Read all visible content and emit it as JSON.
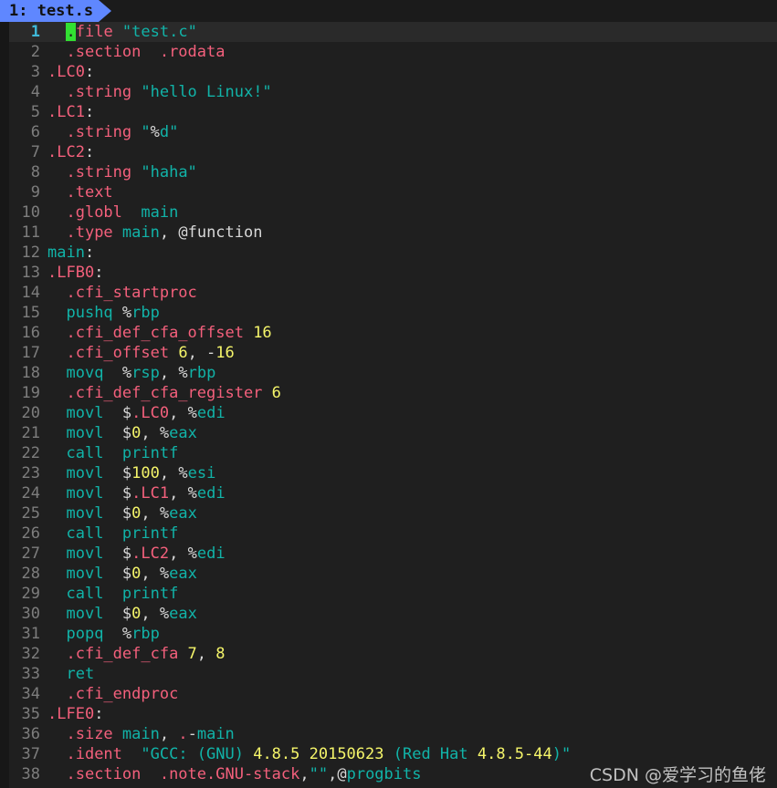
{
  "window": {
    "title": "test.s",
    "colors": {
      "background": "#1f1f1f",
      "tab_background": "#5f87ff",
      "tab_foreground": "#111111",
      "current_line": "#2a2a2a",
      "cursor": "#32e032",
      "line_number": "#7d7d7d",
      "current_line_number": "#3fb9d8",
      "directive": "#f4607c",
      "identifier": "#11b3a8",
      "number": "#f5f56a",
      "punctuation": "#d8d8d8"
    }
  },
  "tabline": {
    "tabs": [
      {
        "index": "1",
        "separator": ": ",
        "name": "test.s",
        "label": "1: test.s",
        "active": true
      }
    ]
  },
  "cursor": {
    "line": 1,
    "column": 3,
    "char": "."
  },
  "editor": {
    "lines": [
      {
        "n": "1",
        "tokens": [
          {
            "t": "  ",
            "c": "plain"
          },
          {
            "t": ".",
            "c": "dir",
            "cursor": true
          },
          {
            "t": "file ",
            "c": "dir"
          },
          {
            "t": "\"test.c\"",
            "c": "id"
          }
        ]
      },
      {
        "n": "2",
        "tokens": [
          {
            "t": "  ",
            "c": "plain"
          },
          {
            "t": ".section  .rodata",
            "c": "dir"
          }
        ]
      },
      {
        "n": "3",
        "tokens": [
          {
            "t": ".LC0",
            "c": "dir"
          },
          {
            "t": ":",
            "c": "pun"
          }
        ]
      },
      {
        "n": "4",
        "tokens": [
          {
            "t": "  ",
            "c": "plain"
          },
          {
            "t": ".string ",
            "c": "dir"
          },
          {
            "t": "\"hello Linux!\"",
            "c": "id"
          }
        ]
      },
      {
        "n": "5",
        "tokens": [
          {
            "t": ".LC1",
            "c": "dir"
          },
          {
            "t": ":",
            "c": "pun"
          }
        ]
      },
      {
        "n": "6",
        "tokens": [
          {
            "t": "  ",
            "c": "plain"
          },
          {
            "t": ".string ",
            "c": "dir"
          },
          {
            "t": "\"",
            "c": "id"
          },
          {
            "t": "%",
            "c": "pun"
          },
          {
            "t": "d\"",
            "c": "id"
          }
        ]
      },
      {
        "n": "7",
        "tokens": [
          {
            "t": ".LC2",
            "c": "dir"
          },
          {
            "t": ":",
            "c": "pun"
          }
        ]
      },
      {
        "n": "8",
        "tokens": [
          {
            "t": "  ",
            "c": "plain"
          },
          {
            "t": ".string ",
            "c": "dir"
          },
          {
            "t": "\"haha\"",
            "c": "id"
          }
        ]
      },
      {
        "n": "9",
        "tokens": [
          {
            "t": "  ",
            "c": "plain"
          },
          {
            "t": ".text",
            "c": "dir"
          }
        ]
      },
      {
        "n": "10",
        "tokens": [
          {
            "t": "  ",
            "c": "plain"
          },
          {
            "t": ".globl",
            "c": "dir"
          },
          {
            "t": "  ",
            "c": "plain"
          },
          {
            "t": "main",
            "c": "id"
          }
        ]
      },
      {
        "n": "11",
        "tokens": [
          {
            "t": "  ",
            "c": "plain"
          },
          {
            "t": ".type ",
            "c": "dir"
          },
          {
            "t": "main",
            "c": "id"
          },
          {
            "t": ", ",
            "c": "pun"
          },
          {
            "t": "@",
            "c": "pun"
          },
          {
            "t": "function",
            "c": "pun"
          }
        ]
      },
      {
        "n": "12",
        "tokens": [
          {
            "t": "main",
            "c": "id"
          },
          {
            "t": ":",
            "c": "pun"
          }
        ]
      },
      {
        "n": "13",
        "tokens": [
          {
            "t": ".LFB0",
            "c": "dir"
          },
          {
            "t": ":",
            "c": "pun"
          }
        ]
      },
      {
        "n": "14",
        "tokens": [
          {
            "t": "  ",
            "c": "plain"
          },
          {
            "t": ".cfi_startproc",
            "c": "dir"
          }
        ]
      },
      {
        "n": "15",
        "tokens": [
          {
            "t": "  ",
            "c": "plain"
          },
          {
            "t": "pushq ",
            "c": "id"
          },
          {
            "t": "%",
            "c": "pun"
          },
          {
            "t": "rbp",
            "c": "id"
          }
        ]
      },
      {
        "n": "16",
        "tokens": [
          {
            "t": "  ",
            "c": "plain"
          },
          {
            "t": ".cfi_def_cfa_offset ",
            "c": "dir"
          },
          {
            "t": "16",
            "c": "num"
          }
        ]
      },
      {
        "n": "17",
        "tokens": [
          {
            "t": "  ",
            "c": "plain"
          },
          {
            "t": ".cfi_offset ",
            "c": "dir"
          },
          {
            "t": "6",
            "c": "num"
          },
          {
            "t": ", ",
            "c": "pun"
          },
          {
            "t": "-",
            "c": "pun"
          },
          {
            "t": "16",
            "c": "num"
          }
        ]
      },
      {
        "n": "18",
        "tokens": [
          {
            "t": "  ",
            "c": "plain"
          },
          {
            "t": "movq  ",
            "c": "id"
          },
          {
            "t": "%",
            "c": "pun"
          },
          {
            "t": "rsp",
            "c": "id"
          },
          {
            "t": ", ",
            "c": "pun"
          },
          {
            "t": "%",
            "c": "pun"
          },
          {
            "t": "rbp",
            "c": "id"
          }
        ]
      },
      {
        "n": "19",
        "tokens": [
          {
            "t": "  ",
            "c": "plain"
          },
          {
            "t": ".cfi_def_cfa_register ",
            "c": "dir"
          },
          {
            "t": "6",
            "c": "num"
          }
        ]
      },
      {
        "n": "20",
        "tokens": [
          {
            "t": "  ",
            "c": "plain"
          },
          {
            "t": "movl  ",
            "c": "id"
          },
          {
            "t": "$",
            "c": "pun"
          },
          {
            "t": ".LC0",
            "c": "dir"
          },
          {
            "t": ", ",
            "c": "pun"
          },
          {
            "t": "%",
            "c": "pun"
          },
          {
            "t": "edi",
            "c": "id"
          }
        ]
      },
      {
        "n": "21",
        "tokens": [
          {
            "t": "  ",
            "c": "plain"
          },
          {
            "t": "movl  ",
            "c": "id"
          },
          {
            "t": "$",
            "c": "pun"
          },
          {
            "t": "0",
            "c": "num"
          },
          {
            "t": ", ",
            "c": "pun"
          },
          {
            "t": "%",
            "c": "pun"
          },
          {
            "t": "eax",
            "c": "id"
          }
        ]
      },
      {
        "n": "22",
        "tokens": [
          {
            "t": "  ",
            "c": "plain"
          },
          {
            "t": "call  printf",
            "c": "id"
          }
        ]
      },
      {
        "n": "23",
        "tokens": [
          {
            "t": "  ",
            "c": "plain"
          },
          {
            "t": "movl  ",
            "c": "id"
          },
          {
            "t": "$",
            "c": "pun"
          },
          {
            "t": "100",
            "c": "num"
          },
          {
            "t": ", ",
            "c": "pun"
          },
          {
            "t": "%",
            "c": "pun"
          },
          {
            "t": "esi",
            "c": "id"
          }
        ]
      },
      {
        "n": "24",
        "tokens": [
          {
            "t": "  ",
            "c": "plain"
          },
          {
            "t": "movl  ",
            "c": "id"
          },
          {
            "t": "$",
            "c": "pun"
          },
          {
            "t": ".LC1",
            "c": "dir"
          },
          {
            "t": ", ",
            "c": "pun"
          },
          {
            "t": "%",
            "c": "pun"
          },
          {
            "t": "edi",
            "c": "id"
          }
        ]
      },
      {
        "n": "25",
        "tokens": [
          {
            "t": "  ",
            "c": "plain"
          },
          {
            "t": "movl  ",
            "c": "id"
          },
          {
            "t": "$",
            "c": "pun"
          },
          {
            "t": "0",
            "c": "num"
          },
          {
            "t": ", ",
            "c": "pun"
          },
          {
            "t": "%",
            "c": "pun"
          },
          {
            "t": "eax",
            "c": "id"
          }
        ]
      },
      {
        "n": "26",
        "tokens": [
          {
            "t": "  ",
            "c": "plain"
          },
          {
            "t": "call  printf",
            "c": "id"
          }
        ]
      },
      {
        "n": "27",
        "tokens": [
          {
            "t": "  ",
            "c": "plain"
          },
          {
            "t": "movl  ",
            "c": "id"
          },
          {
            "t": "$",
            "c": "pun"
          },
          {
            "t": ".LC2",
            "c": "dir"
          },
          {
            "t": ", ",
            "c": "pun"
          },
          {
            "t": "%",
            "c": "pun"
          },
          {
            "t": "edi",
            "c": "id"
          }
        ]
      },
      {
        "n": "28",
        "tokens": [
          {
            "t": "  ",
            "c": "plain"
          },
          {
            "t": "movl  ",
            "c": "id"
          },
          {
            "t": "$",
            "c": "pun"
          },
          {
            "t": "0",
            "c": "num"
          },
          {
            "t": ", ",
            "c": "pun"
          },
          {
            "t": "%",
            "c": "pun"
          },
          {
            "t": "eax",
            "c": "id"
          }
        ]
      },
      {
        "n": "29",
        "tokens": [
          {
            "t": "  ",
            "c": "plain"
          },
          {
            "t": "call  printf",
            "c": "id"
          }
        ]
      },
      {
        "n": "30",
        "tokens": [
          {
            "t": "  ",
            "c": "plain"
          },
          {
            "t": "movl  ",
            "c": "id"
          },
          {
            "t": "$",
            "c": "pun"
          },
          {
            "t": "0",
            "c": "num"
          },
          {
            "t": ", ",
            "c": "pun"
          },
          {
            "t": "%",
            "c": "pun"
          },
          {
            "t": "eax",
            "c": "id"
          }
        ]
      },
      {
        "n": "31",
        "tokens": [
          {
            "t": "  ",
            "c": "plain"
          },
          {
            "t": "popq  ",
            "c": "id"
          },
          {
            "t": "%",
            "c": "pun"
          },
          {
            "t": "rbp",
            "c": "id"
          }
        ]
      },
      {
        "n": "32",
        "tokens": [
          {
            "t": "  ",
            "c": "plain"
          },
          {
            "t": ".cfi_def_cfa ",
            "c": "dir"
          },
          {
            "t": "7",
            "c": "num"
          },
          {
            "t": ", ",
            "c": "pun"
          },
          {
            "t": "8",
            "c": "num"
          }
        ]
      },
      {
        "n": "33",
        "tokens": [
          {
            "t": "  ",
            "c": "plain"
          },
          {
            "t": "ret",
            "c": "id"
          }
        ]
      },
      {
        "n": "34",
        "tokens": [
          {
            "t": "  ",
            "c": "plain"
          },
          {
            "t": ".cfi_endproc",
            "c": "dir"
          }
        ]
      },
      {
        "n": "35",
        "tokens": [
          {
            "t": ".LFE0",
            "c": "dir"
          },
          {
            "t": ":",
            "c": "pun"
          }
        ]
      },
      {
        "n": "36",
        "tokens": [
          {
            "t": "  ",
            "c": "plain"
          },
          {
            "t": ".size ",
            "c": "dir"
          },
          {
            "t": "main",
            "c": "id"
          },
          {
            "t": ", ",
            "c": "pun"
          },
          {
            "t": ".",
            "c": "dir"
          },
          {
            "t": "-",
            "c": "pun"
          },
          {
            "t": "main",
            "c": "id"
          }
        ]
      },
      {
        "n": "37",
        "tokens": [
          {
            "t": "  ",
            "c": "plain"
          },
          {
            "t": ".ident  ",
            "c": "dir"
          },
          {
            "t": "\"GCC: (GNU) ",
            "c": "id"
          },
          {
            "t": "4.8.5 20150623",
            "c": "num"
          },
          {
            "t": " (Red Hat ",
            "c": "id"
          },
          {
            "t": "4.8.5-44",
            "c": "num"
          },
          {
            "t": ")\"",
            "c": "id"
          }
        ]
      },
      {
        "n": "38",
        "tokens": [
          {
            "t": "  ",
            "c": "plain"
          },
          {
            "t": ".section  .note.GNU-stack",
            "c": "dir"
          },
          {
            "t": ",",
            "c": "pun"
          },
          {
            "t": "\"\"",
            "c": "id"
          },
          {
            "t": ",",
            "c": "pun"
          },
          {
            "t": "@",
            "c": "pun"
          },
          {
            "t": "progbits",
            "c": "id"
          }
        ]
      }
    ]
  },
  "watermark": {
    "text": "CSDN @爱学习的鱼佬"
  }
}
